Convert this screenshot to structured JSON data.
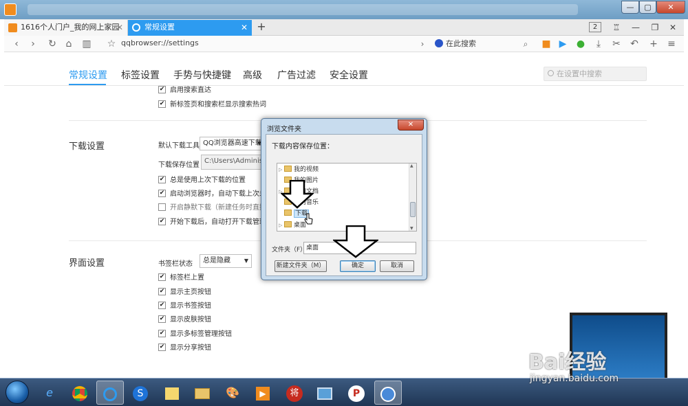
{
  "window": {
    "min_label": "—",
    "max_label": "▢",
    "close_label": "✕"
  },
  "tabs": [
    {
      "label": "1616个人门户_我的网上家园",
      "close": "✕"
    },
    {
      "label": "常规设置",
      "close": "✕"
    }
  ],
  "tabstrip": {
    "new_tab": "+",
    "tab_count": "2"
  },
  "navbar": {
    "url": "qqbrowser://settings",
    "search_engine_label": "在此搜索"
  },
  "settings": {
    "tabs": [
      "常规设置",
      "标签设置",
      "手势与快捷键",
      "高级",
      "广告过滤",
      "安全设置"
    ],
    "search_placeholder": "在设置中搜索",
    "search_section": {
      "items": [
        {
          "label": "启用搜索直达",
          "checked": true
        },
        {
          "label": "新标签页和搜索栏显示搜索热词",
          "checked": true
        }
      ]
    },
    "download_section": {
      "title": "下载设置",
      "tool_label": "默认下载工具",
      "tool_value": "QQ浏览器高速下载",
      "path_label": "下载保存位置",
      "path_value": "C:\\Users\\Administra",
      "items": [
        {
          "label": "总是使用上次下载的位置",
          "checked": true
        },
        {
          "label": "启动浏览器时，自动下载上次未完成",
          "checked": true
        },
        {
          "label": "开启静默下载（新建任务时直接下载",
          "checked": false
        },
        {
          "label": "开始下载后，自动打开下载管理器",
          "checked": true
        }
      ]
    },
    "ui_section": {
      "title": "界面设置",
      "bookmark_bar_label": "书签栏状态",
      "bookmark_bar_value": "总是隐藏",
      "items": [
        {
          "label": "标签栏上置",
          "checked": true
        },
        {
          "label": "显示主页按钮",
          "checked": true
        },
        {
          "label": "显示书签按钮",
          "checked": true
        },
        {
          "label": "显示皮肤按钮",
          "checked": true
        },
        {
          "label": "显示多标签管理按钮",
          "checked": true
        },
        {
          "label": "显示分享按钮",
          "checked": true
        }
      ]
    }
  },
  "dialog": {
    "title": "浏览文件夹",
    "close": "✕",
    "prompt": "下载内容保存位置：",
    "tree": [
      {
        "label": "我的视频",
        "selected": false
      },
      {
        "label": "我的图片",
        "selected": false
      },
      {
        "label": "我的文档",
        "selected": false
      },
      {
        "label": "我的音乐",
        "selected": false
      },
      {
        "label": "下载",
        "selected": true
      },
      {
        "label": "桌面",
        "selected": false
      }
    ],
    "folder_label": "文件夹（F）：",
    "folder_value": "桌面",
    "new_folder_btn": "新建文件夹（M）",
    "ok_btn": "确定",
    "cancel_btn": "取消"
  },
  "watermark": {
    "text": "Bai经验",
    "url": "jingyan.baidu.com"
  },
  "colors": {
    "accent": "#2d9bf0",
    "taskbar": "#2a4468"
  }
}
